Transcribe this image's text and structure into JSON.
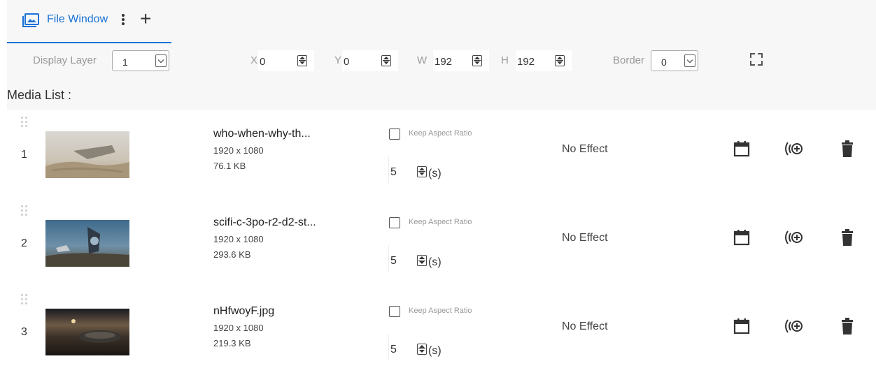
{
  "tab": {
    "icon": "image-window-icon",
    "label": "File Window",
    "menu_icon": "more-vert-icon",
    "add_icon": "plus-icon",
    "accent": "#1a73d6"
  },
  "controls": {
    "display_layer": {
      "label": "Display Layer",
      "value": "1"
    },
    "x": {
      "label": "X",
      "value": "0"
    },
    "y": {
      "label": "Y",
      "value": "0"
    },
    "w": {
      "label": "W",
      "value": "192"
    },
    "h": {
      "label": "H",
      "value": "192"
    },
    "border": {
      "label": "Border",
      "value": "0"
    },
    "fullscreen_icon": "expand-icon"
  },
  "media_list_title": "Media List :",
  "media": [
    {
      "index": "1",
      "name": "who-when-why-th...",
      "resolution": "1920 x 1080",
      "size": "76.1 KB",
      "keep_aspect_label": "Keep Aspect Ratio",
      "keep_aspect": false,
      "duration": "5",
      "duration_unit": "(s)",
      "effect": "No Effect"
    },
    {
      "index": "2",
      "name": "scifi-c-3po-r2-d2-st...",
      "resolution": "1920 x 1080",
      "size": "293.6 KB",
      "keep_aspect_label": "Keep Aspect Ratio",
      "keep_aspect": false,
      "duration": "5",
      "duration_unit": "(s)",
      "effect": "No Effect"
    },
    {
      "index": "3",
      "name": "nHfwoyF.jpg",
      "resolution": "1920 x 1080",
      "size": "219.3 KB",
      "keep_aspect_label": "Keep Aspect Ratio",
      "keep_aspect": false,
      "duration": "5",
      "duration_unit": "(s)",
      "effect": "No Effect"
    }
  ],
  "row_icons": {
    "schedule": "calendar-icon",
    "cast": "add-cast-icon",
    "delete": "trash-icon"
  }
}
